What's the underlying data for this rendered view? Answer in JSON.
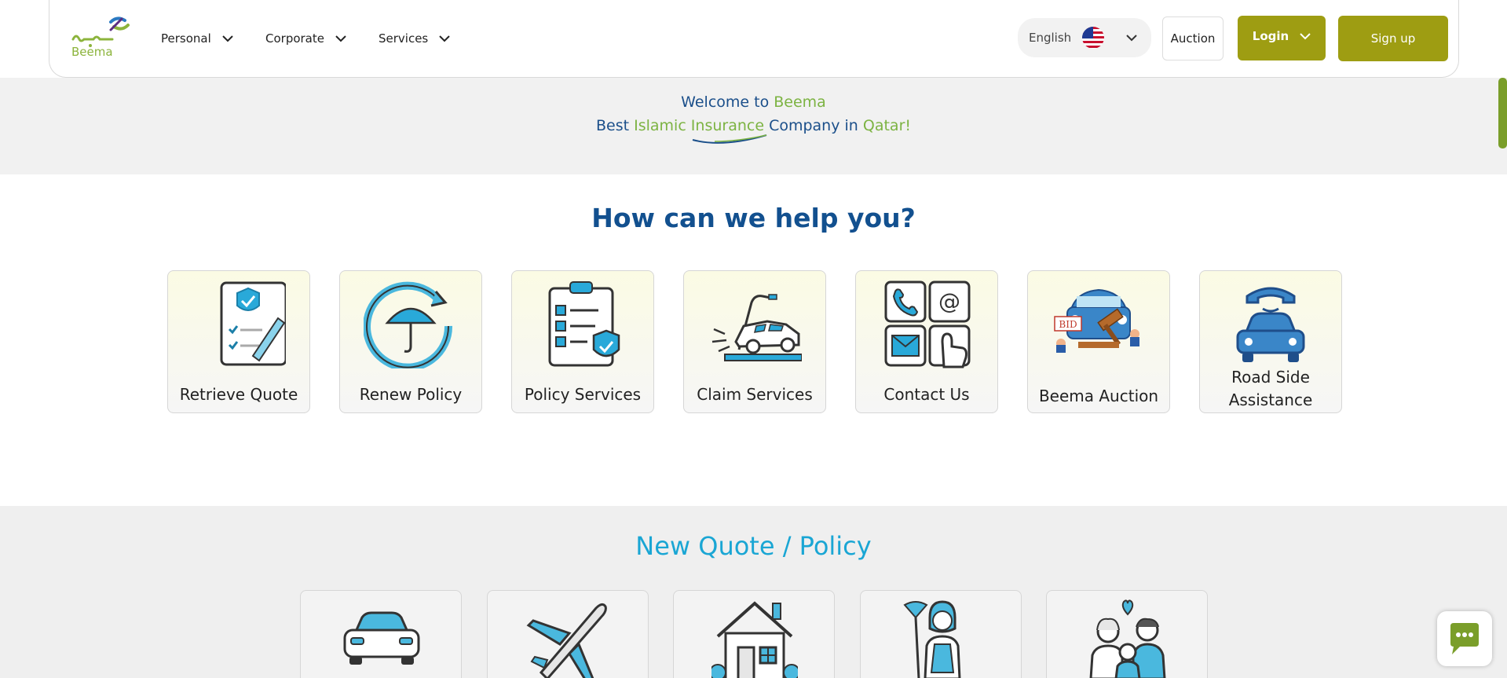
{
  "header": {
    "logo_text": "Beema",
    "nav": [
      {
        "label": "Personal"
      },
      {
        "label": "Corporate"
      },
      {
        "label": "Services"
      }
    ],
    "language": "English",
    "auction_label": "Auction",
    "login_label": "Login",
    "signup_label": "Sign up"
  },
  "banner": {
    "line1_pre": "Welcome to ",
    "line1_brand": "Beema",
    "line2_pre": "Best ",
    "line2_green": "Islamic Insurance",
    "line2_mid": " Company in ",
    "line2_end": "Qatar!"
  },
  "help": {
    "title": "How can we help you?",
    "cards": [
      {
        "label": "Retrieve Quote",
        "icon": "retrieve-quote-icon"
      },
      {
        "label": "Renew Policy",
        "icon": "renew-policy-icon"
      },
      {
        "label": "Policy Services",
        "icon": "policy-services-icon"
      },
      {
        "label": "Claim Services",
        "icon": "claim-services-icon"
      },
      {
        "label": "Contact Us",
        "icon": "contact-us-icon"
      },
      {
        "label": "Beema Auction",
        "icon": "auction-icon"
      },
      {
        "label": "Road Side Assistance",
        "icon": "roadside-assistance-icon"
      }
    ]
  },
  "quote": {
    "title": "New Quote / Policy",
    "cards": [
      {
        "icon": "car-icon"
      },
      {
        "icon": "airplane-icon"
      },
      {
        "icon": "house-icon"
      },
      {
        "icon": "housemaid-icon"
      },
      {
        "icon": "family-icon"
      }
    ]
  },
  "colors": {
    "brand_olive": "#9e9d12",
    "brand_green": "#7cb342",
    "navy": "#12508f",
    "cyan": "#1aa6d4"
  }
}
